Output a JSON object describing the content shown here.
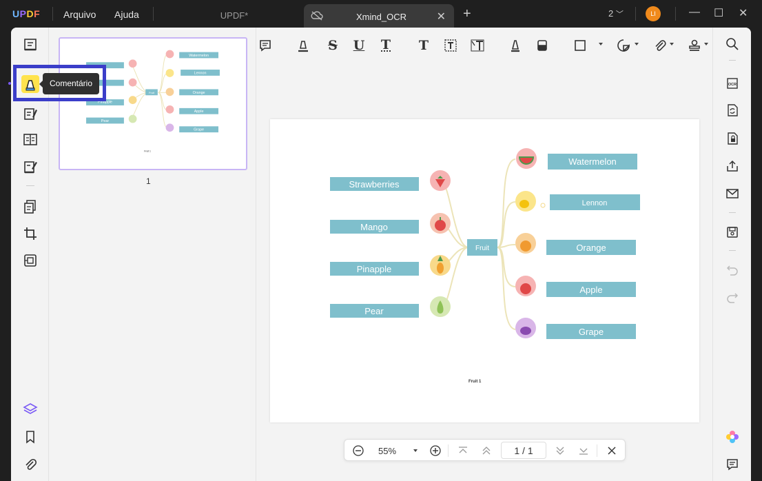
{
  "app": {
    "logo": [
      "U",
      "P",
      "D",
      "F"
    ]
  },
  "menu": {
    "file": "Arquivo",
    "help": "Ajuda"
  },
  "tabs": [
    {
      "label": "UPDF*",
      "active": false
    },
    {
      "label": "Xmind_OCR",
      "active": true
    }
  ],
  "titlebar": {
    "page_count": "2",
    "avatar": "LI"
  },
  "tooltip": {
    "label": "Comentário"
  },
  "thumbnail": {
    "page_number": "1"
  },
  "zoom": {
    "value": "55%",
    "current_page": "1",
    "separator": "/",
    "total_pages": "1"
  },
  "mindmap": {
    "center": "Fruit",
    "left": [
      "Strawberries",
      "Mango",
      "Pinapple",
      "Pear"
    ],
    "right": [
      "Watermelon",
      "Lennon",
      "Orange",
      "Apple",
      "Grape"
    ],
    "footer": "Fruit 1"
  },
  "colors": {
    "accent": "#7a5af5",
    "highlight_box": "#3b3ec9",
    "node_fill": "#7fbfcc",
    "branch_line": "#ece4b8"
  }
}
